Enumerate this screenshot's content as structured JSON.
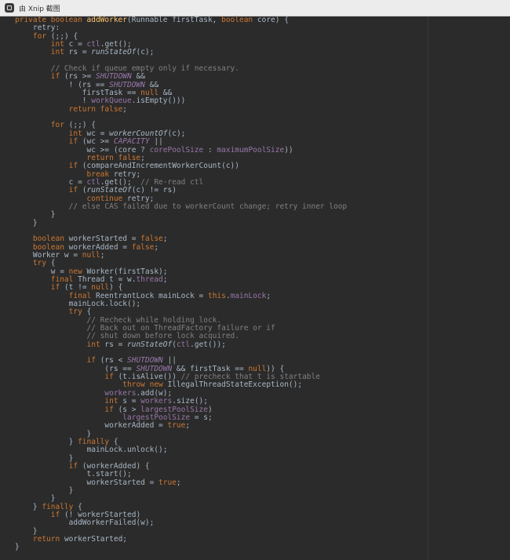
{
  "window": {
    "title": "由 Xnip 截图"
  },
  "code_lines": [
    [
      [
        "kw",
        "private boolean "
      ],
      [
        "fn",
        "addWorker"
      ],
      [
        "txt",
        "(Runnable firstTask, "
      ],
      [
        "kw",
        "boolean "
      ],
      [
        "txt",
        "core) {"
      ]
    ],
    [
      [
        "txt",
        "    retry:"
      ]
    ],
    [
      [
        "txt",
        "    "
      ],
      [
        "kw",
        "for "
      ],
      [
        "txt",
        "(;;) {"
      ]
    ],
    [
      [
        "txt",
        "        "
      ],
      [
        "kw",
        "int "
      ],
      [
        "txt",
        "c = "
      ],
      [
        "fld",
        "ctl"
      ],
      [
        "txt",
        ".get();"
      ]
    ],
    [
      [
        "txt",
        "        "
      ],
      [
        "kw",
        "int "
      ],
      [
        "txt",
        "rs = "
      ],
      [
        "sm",
        "runStateOf"
      ],
      [
        "txt",
        "(c);"
      ]
    ],
    [
      [
        "txt",
        ""
      ]
    ],
    [
      [
        "txt",
        "        "
      ],
      [
        "cm",
        "// Check if queue empty only if necessary."
      ]
    ],
    [
      [
        "txt",
        "        "
      ],
      [
        "kw",
        "if "
      ],
      [
        "txt",
        "(rs >= "
      ],
      [
        "cst",
        "SHUTDOWN"
      ],
      [
        "txt",
        " &&"
      ]
    ],
    [
      [
        "txt",
        "            ! (rs == "
      ],
      [
        "cst",
        "SHUTDOWN"
      ],
      [
        "txt",
        " &&"
      ]
    ],
    [
      [
        "txt",
        "               firstTask == "
      ],
      [
        "kw",
        "null"
      ],
      [
        "txt",
        " &&"
      ]
    ],
    [
      [
        "txt",
        "               ! "
      ],
      [
        "fld",
        "workQueue"
      ],
      [
        "txt",
        ".isEmpty()))"
      ]
    ],
    [
      [
        "txt",
        "            "
      ],
      [
        "kw",
        "return false"
      ],
      [
        "txt",
        ";"
      ]
    ],
    [
      [
        "txt",
        ""
      ]
    ],
    [
      [
        "txt",
        "        "
      ],
      [
        "kw",
        "for "
      ],
      [
        "txt",
        "(;;) {"
      ]
    ],
    [
      [
        "txt",
        "            "
      ],
      [
        "kw",
        "int "
      ],
      [
        "txt",
        "wc = "
      ],
      [
        "sm",
        "workerCountOf"
      ],
      [
        "txt",
        "(c);"
      ]
    ],
    [
      [
        "txt",
        "            "
      ],
      [
        "kw",
        "if "
      ],
      [
        "txt",
        "(wc >= "
      ],
      [
        "cst",
        "CAPACITY"
      ],
      [
        "txt",
        " ||"
      ]
    ],
    [
      [
        "txt",
        "                wc >= (core ? "
      ],
      [
        "fld",
        "corePoolSize"
      ],
      [
        "txt",
        " : "
      ],
      [
        "fld",
        "maximumPoolSize"
      ],
      [
        "txt",
        "))"
      ]
    ],
    [
      [
        "txt",
        "                "
      ],
      [
        "kw",
        "return false"
      ],
      [
        "txt",
        ";"
      ]
    ],
    [
      [
        "txt",
        "            "
      ],
      [
        "kw",
        "if "
      ],
      [
        "txt",
        "(compareAndIncrementWorkerCount(c))"
      ]
    ],
    [
      [
        "txt",
        "                "
      ],
      [
        "kw",
        "break "
      ],
      [
        "txt",
        "retry;"
      ]
    ],
    [
      [
        "txt",
        "            c = "
      ],
      [
        "fld",
        "ctl"
      ],
      [
        "txt",
        ".get();  "
      ],
      [
        "cm",
        "// Re-read ctl"
      ]
    ],
    [
      [
        "txt",
        "            "
      ],
      [
        "kw",
        "if "
      ],
      [
        "txt",
        "("
      ],
      [
        "sm",
        "runStateOf"
      ],
      [
        "txt",
        "(c) != rs)"
      ]
    ],
    [
      [
        "txt",
        "                "
      ],
      [
        "kw",
        "continue "
      ],
      [
        "txt",
        "retry;"
      ]
    ],
    [
      [
        "txt",
        "            "
      ],
      [
        "cm",
        "// else CAS failed due to workerCount change; retry inner loop"
      ]
    ],
    [
      [
        "txt",
        "        }"
      ]
    ],
    [
      [
        "txt",
        "    }"
      ]
    ],
    [
      [
        "txt",
        ""
      ]
    ],
    [
      [
        "txt",
        "    "
      ],
      [
        "kw",
        "boolean "
      ],
      [
        "txt",
        "workerStarted = "
      ],
      [
        "kw",
        "false"
      ],
      [
        "txt",
        ";"
      ]
    ],
    [
      [
        "txt",
        "    "
      ],
      [
        "kw",
        "boolean "
      ],
      [
        "txt",
        "workerAdded = "
      ],
      [
        "kw",
        "false"
      ],
      [
        "txt",
        ";"
      ]
    ],
    [
      [
        "txt",
        "    Worker w = "
      ],
      [
        "kw",
        "null"
      ],
      [
        "txt",
        ";"
      ]
    ],
    [
      [
        "txt",
        "    "
      ],
      [
        "kw",
        "try "
      ],
      [
        "txt",
        "{"
      ]
    ],
    [
      [
        "txt",
        "        w = "
      ],
      [
        "kw",
        "new "
      ],
      [
        "txt",
        "Worker(firstTask);"
      ]
    ],
    [
      [
        "txt",
        "        "
      ],
      [
        "kw",
        "final "
      ],
      [
        "txt",
        "Thread t = w."
      ],
      [
        "fld",
        "thread"
      ],
      [
        "txt",
        ";"
      ]
    ],
    [
      [
        "txt",
        "        "
      ],
      [
        "kw",
        "if "
      ],
      [
        "txt",
        "(t != "
      ],
      [
        "kw",
        "null"
      ],
      [
        "txt",
        ") {"
      ]
    ],
    [
      [
        "txt",
        "            "
      ],
      [
        "kw",
        "final "
      ],
      [
        "txt",
        "ReentrantLock mainLock = "
      ],
      [
        "kw",
        "this"
      ],
      [
        "txt",
        "."
      ],
      [
        "fld",
        "mainLock"
      ],
      [
        "txt",
        ";"
      ]
    ],
    [
      [
        "txt",
        "            mainLock.lock();"
      ]
    ],
    [
      [
        "txt",
        "            "
      ],
      [
        "kw",
        "try "
      ],
      [
        "txt",
        "{"
      ]
    ],
    [
      [
        "txt",
        "                "
      ],
      [
        "cm",
        "// Recheck while holding lock."
      ]
    ],
    [
      [
        "txt",
        "                "
      ],
      [
        "cm",
        "// Back out on ThreadFactory failure or if"
      ]
    ],
    [
      [
        "txt",
        "                "
      ],
      [
        "cm",
        "// shut down before lock acquired."
      ]
    ],
    [
      [
        "txt",
        "                "
      ],
      [
        "kw",
        "int "
      ],
      [
        "txt",
        "rs = "
      ],
      [
        "sm",
        "runStateOf"
      ],
      [
        "txt",
        "("
      ],
      [
        "fld",
        "ctl"
      ],
      [
        "txt",
        ".get());"
      ]
    ],
    [
      [
        "txt",
        ""
      ]
    ],
    [
      [
        "txt",
        "                "
      ],
      [
        "kw",
        "if "
      ],
      [
        "txt",
        "(rs < "
      ],
      [
        "cst",
        "SHUTDOWN"
      ],
      [
        "txt",
        " ||"
      ]
    ],
    [
      [
        "txt",
        "                    (rs == "
      ],
      [
        "cst",
        "SHUTDOWN"
      ],
      [
        "txt",
        " && firstTask == "
      ],
      [
        "kw",
        "null"
      ],
      [
        "txt",
        ")) {"
      ]
    ],
    [
      [
        "txt",
        "                    "
      ],
      [
        "kw",
        "if "
      ],
      [
        "txt",
        "(t.isAlive()) "
      ],
      [
        "cm",
        "// precheck that t is startable"
      ]
    ],
    [
      [
        "txt",
        "                        "
      ],
      [
        "kw",
        "throw new "
      ],
      [
        "txt",
        "IllegalThreadStateException();"
      ]
    ],
    [
      [
        "txt",
        "                    "
      ],
      [
        "fld",
        "workers"
      ],
      [
        "txt",
        ".add(w);"
      ]
    ],
    [
      [
        "txt",
        "                    "
      ],
      [
        "kw",
        "int "
      ],
      [
        "txt",
        "s = "
      ],
      [
        "fld",
        "workers"
      ],
      [
        "txt",
        ".size();"
      ]
    ],
    [
      [
        "txt",
        "                    "
      ],
      [
        "kw",
        "if "
      ],
      [
        "txt",
        "(s > "
      ],
      [
        "fld",
        "largestPoolSize"
      ],
      [
        "txt",
        ")"
      ]
    ],
    [
      [
        "txt",
        "                        "
      ],
      [
        "fld",
        "largestPoolSize"
      ],
      [
        "txt",
        " = s;"
      ]
    ],
    [
      [
        "txt",
        "                    workerAdded = "
      ],
      [
        "kw",
        "true"
      ],
      [
        "txt",
        ";"
      ]
    ],
    [
      [
        "txt",
        "                }"
      ]
    ],
    [
      [
        "txt",
        "            } "
      ],
      [
        "kw",
        "finally "
      ],
      [
        "txt",
        "{"
      ]
    ],
    [
      [
        "txt",
        "                mainLock.unlock();"
      ]
    ],
    [
      [
        "txt",
        "            }"
      ]
    ],
    [
      [
        "txt",
        "            "
      ],
      [
        "kw",
        "if "
      ],
      [
        "txt",
        "(workerAdded) {"
      ]
    ],
    [
      [
        "txt",
        "                t.start();"
      ]
    ],
    [
      [
        "txt",
        "                workerStarted = "
      ],
      [
        "kw",
        "true"
      ],
      [
        "txt",
        ";"
      ]
    ],
    [
      [
        "txt",
        "            }"
      ]
    ],
    [
      [
        "txt",
        "        }"
      ]
    ],
    [
      [
        "txt",
        "    } "
      ],
      [
        "kw",
        "finally "
      ],
      [
        "txt",
        "{"
      ]
    ],
    [
      [
        "txt",
        "        "
      ],
      [
        "kw",
        "if "
      ],
      [
        "txt",
        "(! workerStarted)"
      ]
    ],
    [
      [
        "txt",
        "            addWorkerFailed(w);"
      ]
    ],
    [
      [
        "txt",
        "    }"
      ]
    ],
    [
      [
        "txt",
        "    "
      ],
      [
        "kw",
        "return "
      ],
      [
        "txt",
        "workerStarted;"
      ]
    ],
    [
      [
        "txt",
        "}"
      ]
    ]
  ]
}
